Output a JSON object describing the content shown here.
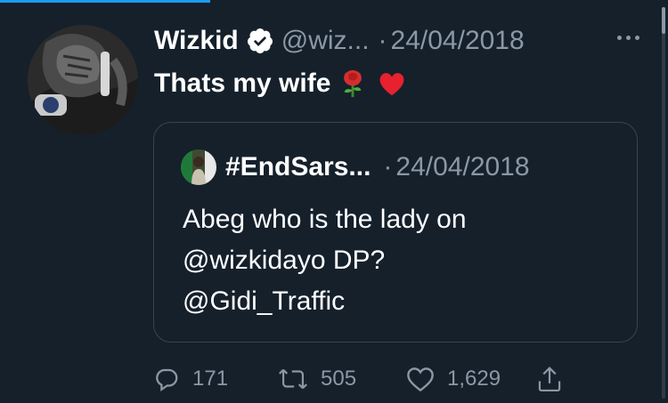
{
  "tweet": {
    "author_name": "Wizkid",
    "handle": "@wiz...",
    "separator": "·",
    "timestamp": "24/04/2018",
    "text": "Thats my wife",
    "emojis": [
      "rose-emoji",
      "red-heart-emoji"
    ]
  },
  "quote": {
    "author_name": "#EndSars...",
    "separator": "·",
    "timestamp": "24/04/2018",
    "lines": [
      "Abeg who is the lady on",
      "@wizkidayo DP?",
      "@Gidi_Traffic"
    ]
  },
  "actions": {
    "reply_count": "171",
    "retweet_count": "505",
    "like_count": "1,629"
  },
  "icons": {
    "verified": "verified-badge-icon",
    "more": "more-icon",
    "reply": "reply-icon",
    "retweet": "retweet-icon",
    "like": "like-icon",
    "share": "share-icon"
  },
  "colors": {
    "background": "#15202b",
    "secondary_text": "#8b98a5",
    "accent": "#1d9bf0",
    "border": "#38444d"
  }
}
